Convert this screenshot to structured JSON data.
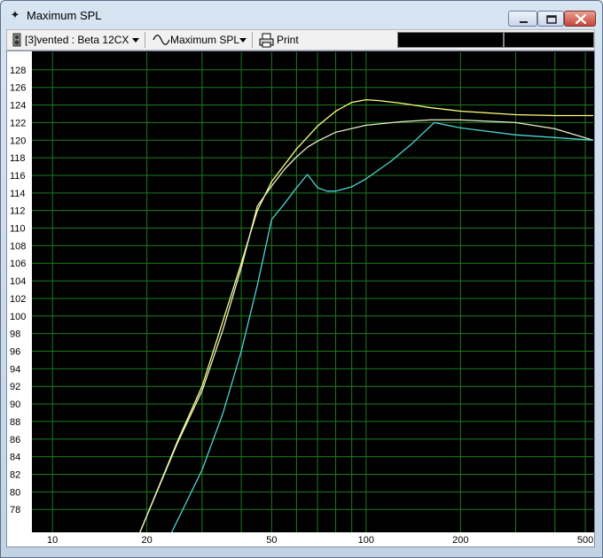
{
  "window": {
    "title": "Maximum SPL"
  },
  "toolbar": {
    "driver_label": "[3]vented : Beta 12CX",
    "graph_label": "Maximum SPL",
    "print_label": "Print"
  },
  "chart_data": {
    "type": "line",
    "title": "",
    "xlabel": "",
    "ylabel": "",
    "x_scale": "log",
    "xlim": [
      8.6,
      530
    ],
    "ylim": [
      75.4,
      130
    ],
    "x_tick_labels": [
      {
        "value": 10,
        "label": "10"
      },
      {
        "value": 20,
        "label": "20"
      },
      {
        "value": 50,
        "label": "50"
      },
      {
        "value": 100,
        "label": "100"
      },
      {
        "value": 200,
        "label": "200"
      },
      {
        "value": 500,
        "label": "500"
      }
    ],
    "x_gridlines": [
      10,
      20,
      30,
      40,
      50,
      60,
      70,
      80,
      90,
      100,
      200,
      300,
      400,
      500
    ],
    "y_ticks": [
      78,
      80,
      82,
      84,
      86,
      88,
      90,
      92,
      94,
      96,
      98,
      100,
      102,
      104,
      106,
      108,
      110,
      112,
      114,
      116,
      118,
      120,
      122,
      124,
      126,
      128
    ],
    "grid": true,
    "colors": {
      "background": "#000000",
      "grid": "#1f7a1f",
      "axis_text": "#000000"
    },
    "series": [
      {
        "color": "#ffff80",
        "x": [
          19,
          25,
          30,
          35,
          40,
          45,
          50,
          60,
          70,
          80,
          90,
          100,
          110,
          130,
          160,
          200,
          300,
          400,
          530
        ],
        "y": [
          75.4,
          85.7,
          92.0,
          99.5,
          106.0,
          112.0,
          115.3,
          119.0,
          121.6,
          123.3,
          124.3,
          124.6,
          124.5,
          124.2,
          123.7,
          123.3,
          122.9,
          122.8,
          122.8
        ]
      },
      {
        "color": "#e8f2c8",
        "x": [
          19,
          25,
          30,
          35,
          40,
          45,
          50,
          55,
          60,
          65,
          70,
          80,
          100,
          130,
          160,
          200,
          300,
          400,
          530
        ],
        "y": [
          75.4,
          85.5,
          91.5,
          98.5,
          105.5,
          112.5,
          114.8,
          116.7,
          118.1,
          119.2,
          119.9,
          120.9,
          121.7,
          122.1,
          122.3,
          122.3,
          122.0,
          121.3,
          120.0
        ]
      },
      {
        "color": "#4fd4d4",
        "x": [
          24,
          30,
          35,
          40,
          45,
          50,
          55,
          60,
          65,
          70,
          75,
          80,
          90,
          100,
          120,
          140,
          165,
          200,
          300,
          400,
          530
        ],
        "y": [
          75.4,
          82.5,
          89.0,
          96.0,
          103.5,
          111.0,
          112.8,
          114.6,
          116.1,
          114.6,
          114.2,
          114.2,
          114.7,
          115.6,
          117.6,
          119.6,
          122.0,
          121.4,
          120.6,
          120.3,
          120.0
        ]
      }
    ]
  }
}
